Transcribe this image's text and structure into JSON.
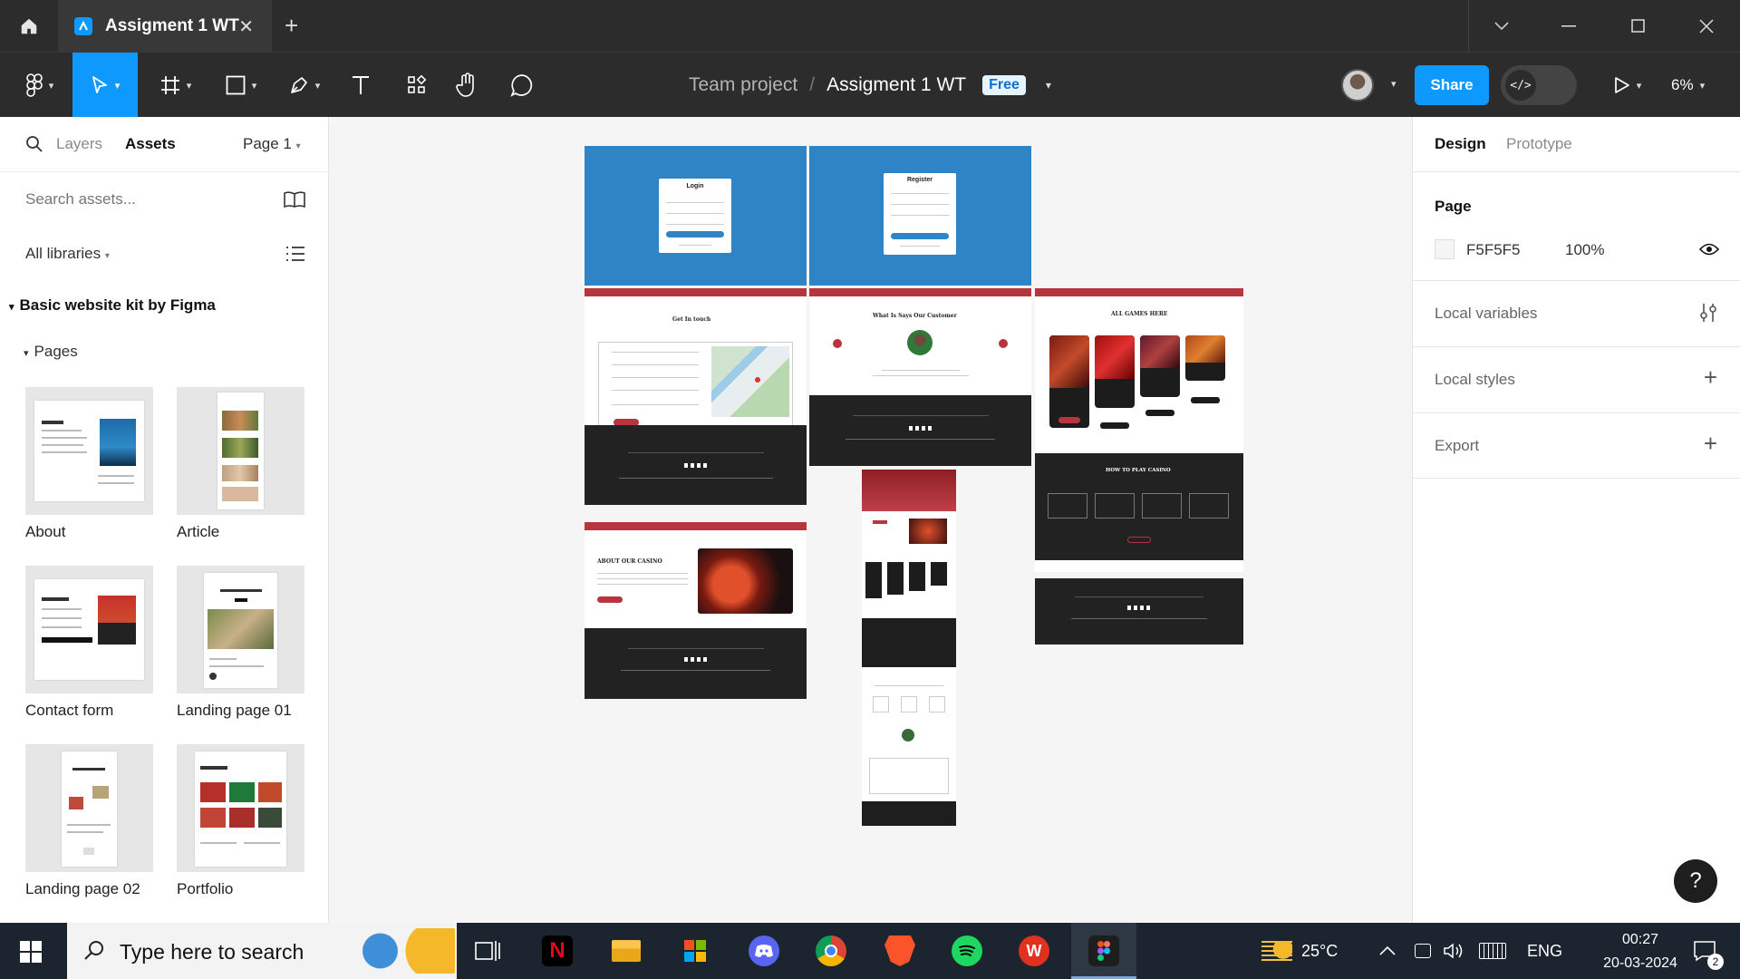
{
  "window": {
    "tab_title": "Assigment 1 WT",
    "close_glyph": "✕",
    "new_tab_glyph": "+"
  },
  "toolbar": {
    "breadcrumb_team": "Team project",
    "breadcrumb_separator": "/",
    "file_name": "Assigment 1 WT",
    "plan_badge": "Free",
    "share_label": "Share",
    "dev_mode_glyph": "</>",
    "zoom_level": "6%"
  },
  "left_panel": {
    "tabs": {
      "layers": "Layers",
      "assets": "Assets",
      "page_selector": "Page 1"
    },
    "search_placeholder": "Search assets...",
    "libraries_label": "All libraries",
    "kit_title": "Basic website kit by Figma",
    "pages_heading": "Pages",
    "pages": [
      {
        "label": "About"
      },
      {
        "label": "Article"
      },
      {
        "label": "Contact form"
      },
      {
        "label": "Landing page 01"
      },
      {
        "label": "Landing page 02"
      },
      {
        "label": "Portfolio"
      }
    ]
  },
  "canvas": {
    "frames": {
      "login_title": "Login",
      "register_title": "Register",
      "get_in_touch": "Get In touch",
      "testimonials": "What Is Says Our Customer",
      "all_games": "ALL GAMES HERE",
      "about_casino": "ABOUT OUR CASINO",
      "how_to_play": "HOW TO PLAY CASINO"
    }
  },
  "right_panel": {
    "tabs": {
      "design": "Design",
      "prototype": "Prototype"
    },
    "page_heading": "Page",
    "page_color_hex": "F5F5F5",
    "page_opacity": "100%",
    "sections": {
      "local_variables": "Local variables",
      "local_styles": "Local styles",
      "export": "Export"
    },
    "help_glyph": "?"
  },
  "taskbar": {
    "search_placeholder": "Type here to search",
    "temperature": "25°C",
    "language": "ENG",
    "time": "00:27",
    "date": "20-03-2024",
    "notification_count": "2"
  },
  "colors": {
    "accent": "#0d99ff",
    "casino_red": "#b8343e",
    "frame_blue": "#2f84c6",
    "canvas_bg": "#F5F5F5"
  }
}
